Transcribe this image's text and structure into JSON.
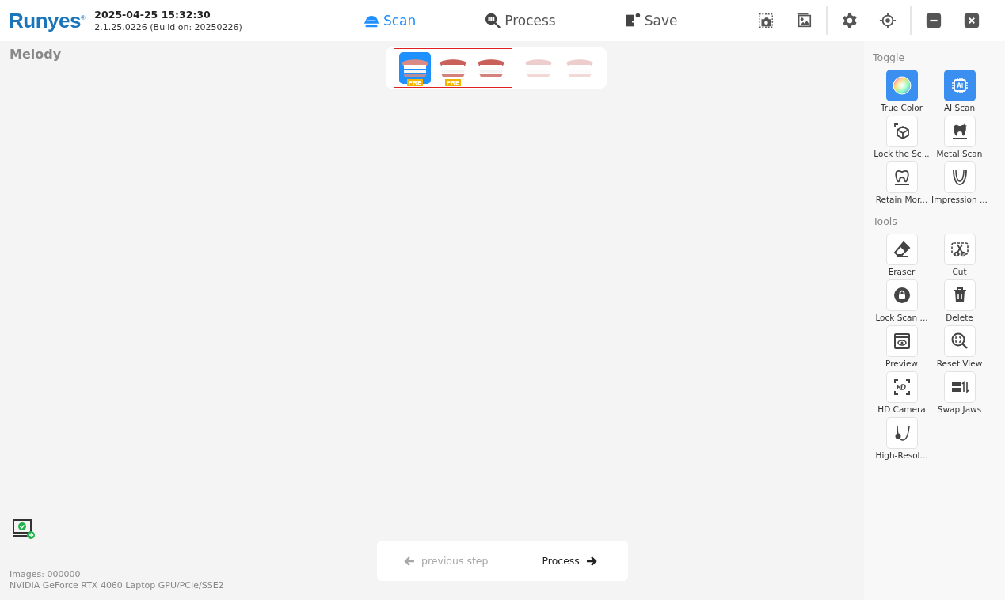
{
  "header": {
    "logo": "Runyes$^{®}$",
    "datetime": "2025-04-25 15:32:30",
    "version": "2.1.25.0226 (Build on: 20250226)"
  },
  "steps": [
    {
      "label": "Scan",
      "selected": true
    },
    {
      "label": "Process",
      "selected": false
    },
    {
      "label": "Save",
      "selected": false
    }
  ],
  "patient": {
    "name": "Melody"
  },
  "jaw_selector": [
    {
      "selected": true,
      "disabled": false,
      "badge": "PRE"
    },
    {
      "selected": false,
      "disabled": false,
      "badge": "PRE"
    },
    {
      "selected": false,
      "disabled": false
    },
    {
      "selected": false,
      "disabled": true
    },
    {
      "selected": false,
      "disabled": true
    }
  ],
  "sidebar": {
    "sections": [
      {
        "title": "Toggle",
        "items": [
          {
            "label": "True Color",
            "on": true
          },
          {
            "label": "AI Scan",
            "on": true
          },
          {
            "label": "Lock the Sc...",
            "on": false
          },
          {
            "label": "Metal Scan",
            "on": false
          },
          {
            "label": "Retain Mor...",
            "on": false
          },
          {
            "label": "Impression ...",
            "on": false
          }
        ]
      },
      {
        "title": "Tools",
        "items": [
          {
            "label": "Eraser"
          },
          {
            "label": "Cut"
          },
          {
            "label": "Lock Scan ..."
          },
          {
            "label": "Delete"
          },
          {
            "label": "Preview"
          },
          {
            "label": "Reset View"
          },
          {
            "label": "HD Camera"
          },
          {
            "label": "Swap Jaws"
          },
          {
            "label": "High-Resol..."
          }
        ]
      }
    ]
  },
  "status": {
    "images": "Images: 000000",
    "gpu": "NVIDIA GeForce RTX 4060 Laptop GPU/PCIe/SSE2"
  },
  "navigation": {
    "previous": {
      "label": "previous step",
      "disabled": true
    },
    "next": {
      "label": "Process",
      "disabled": false
    }
  }
}
